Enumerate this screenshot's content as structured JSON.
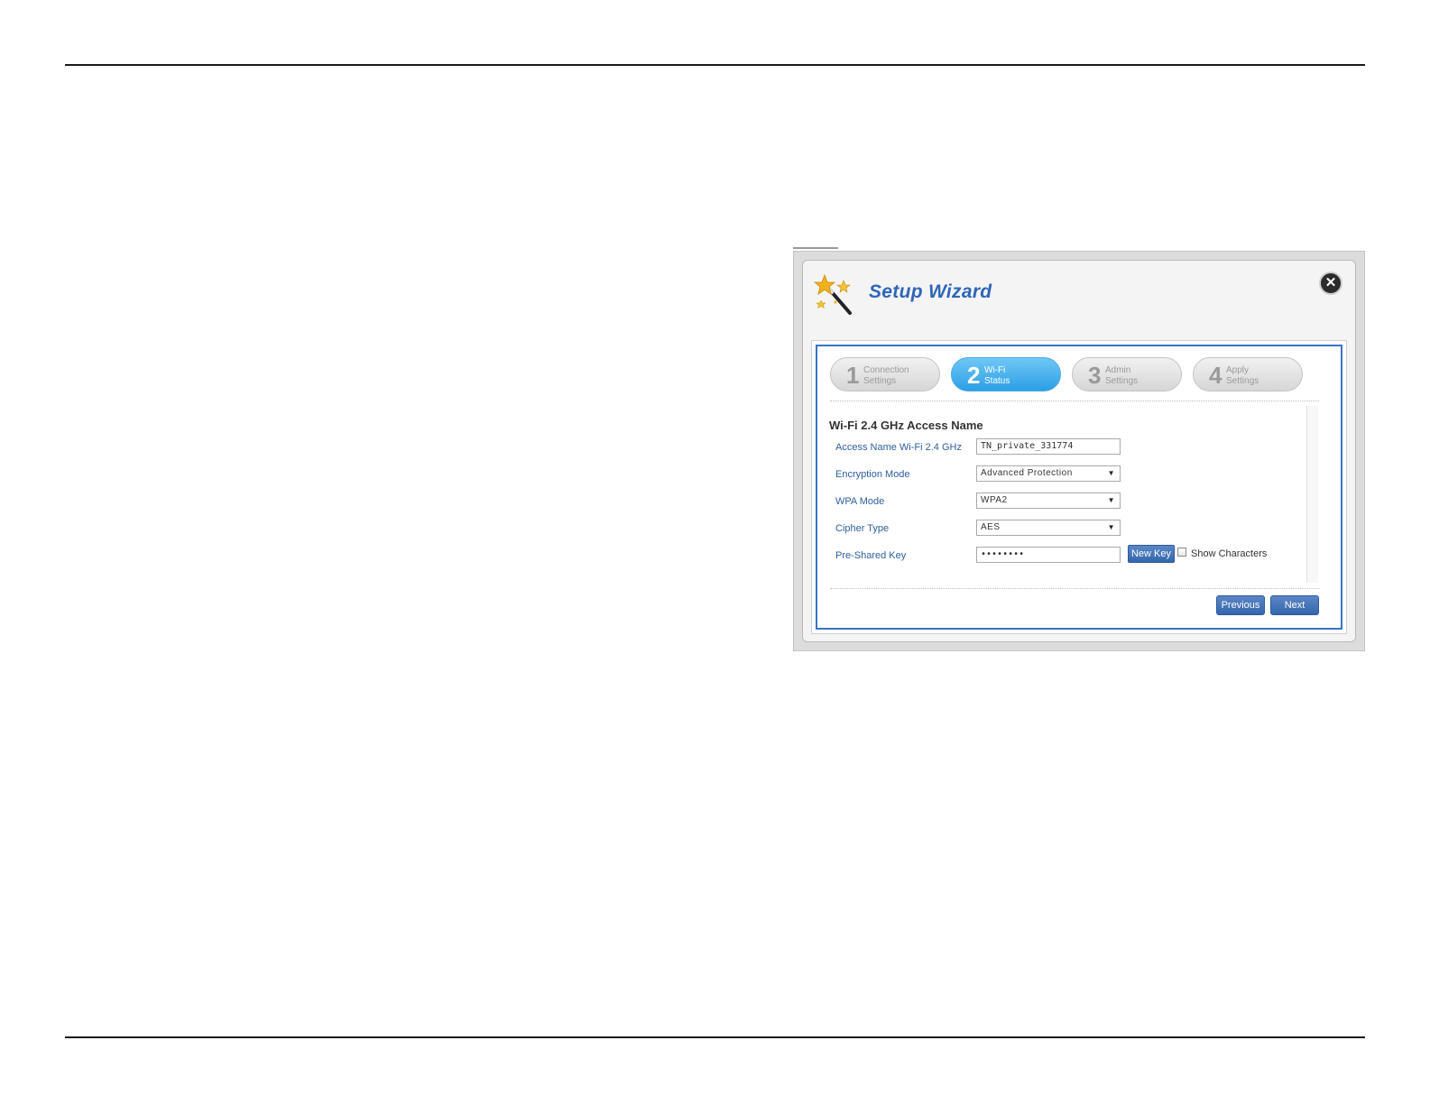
{
  "dialog": {
    "title": "Setup Wizard",
    "close_symbol": "✕"
  },
  "steps": [
    {
      "number": "1",
      "label": "Connection\nSettings",
      "active": false
    },
    {
      "number": "2",
      "label": "Wi-Fi\nStatus",
      "active": true
    },
    {
      "number": "3",
      "label": "Admin\nSettings",
      "active": false
    },
    {
      "number": "4",
      "label": "Apply\nSettings",
      "active": false
    }
  ],
  "form": {
    "section_title": "Wi-Fi 2.4 GHz Access Name",
    "access_name_label": "Access Name Wi-Fi 2.4 GHz",
    "access_name_value": "TN_private_331774",
    "encryption_label": "Encryption Mode",
    "encryption_value": "Advanced Protection",
    "wpa_label": "WPA Mode",
    "wpa_value": "WPA2",
    "cipher_label": "Cipher Type",
    "cipher_value": "AES",
    "psk_label": "Pre-Shared Key",
    "psk_value": "••••••••",
    "new_key_label": "New Key",
    "show_chars_label": "Show Characters",
    "dropdown_arrow": "▼"
  },
  "nav": {
    "previous_label": "Previous",
    "next_label": "Next"
  },
  "colors": {
    "accent": "#2e66b8",
    "active_step": "#2c9fe6",
    "button": "#3566ad"
  }
}
